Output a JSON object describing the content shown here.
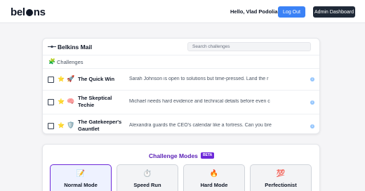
{
  "nav": {
    "logo_pre": "bel",
    "logo_post": "ns",
    "greeting": "Hello, Vlad Podoliako",
    "logout_label": "Log Out",
    "admin_label": "Admin Dashboard"
  },
  "mail": {
    "app_title": "Belkins Mail",
    "search_placeholder": "Search challenges",
    "section_icon": "🧩",
    "section_label": "Challenges",
    "rows": [
      {
        "star": "⭐",
        "emoji": "🚀",
        "title": "The Quick Win",
        "preview": "Sarah Johnson is open to solutions but time-pressed. Land the r"
      },
      {
        "star": "⭐",
        "emoji": "🧠",
        "title": "The Skeptical Techie",
        "preview": "Michael needs hard evidence and technical details before even c"
      },
      {
        "star": "⭐",
        "emoji": "🛡️",
        "title": "The Gatekeeper's Gauntlet",
        "preview": "Alexandra guards the CEO's calendar like a fortress. Can you bre"
      }
    ],
    "info_glyph": "i"
  },
  "modes": {
    "title": "Challenge Modes",
    "badge": "BETA",
    "items": [
      {
        "icon": "📝",
        "label": "Normal Mode",
        "selected": true
      },
      {
        "icon": "⏱️",
        "label": "Speed Run",
        "selected": false
      },
      {
        "icon": "🔥",
        "label": "Hard Mode",
        "selected": false
      },
      {
        "icon": "💯",
        "label": "Perfectionist",
        "selected": false
      }
    ]
  },
  "colors": {
    "primary_button": "#3b82f6",
    "admin_button": "#1f2937",
    "accent_purple": "#6d28d9",
    "star": "#f5b400"
  }
}
